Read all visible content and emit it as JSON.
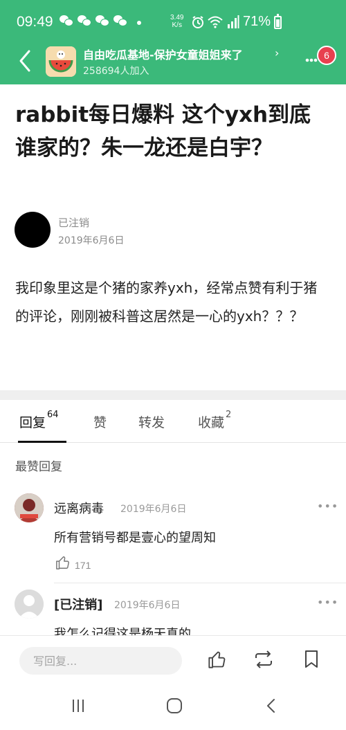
{
  "status": {
    "time": "09:49",
    "speed_top": "3.49",
    "speed_bottom": "K/s",
    "battery": "71%"
  },
  "header": {
    "group_name": "自由吃瓜基地-保护女童姐姐来了",
    "members": "258694人加入",
    "badge": "6"
  },
  "post": {
    "title": "rabbit每日爆料 这个yxh到底谁家的？朱一龙还是白宇？",
    "author": "已注销",
    "date": "2019年6月6日",
    "body": "我印象里这是个猪的家养yxh，经常点赞有利于猪的评论，刚刚被科普这居然是一心的yxh？？？"
  },
  "tabs": [
    {
      "label": "回复",
      "count": "64"
    },
    {
      "label": "赞",
      "count": ""
    },
    {
      "label": "转发",
      "count": ""
    },
    {
      "label": "收藏",
      "count": "2"
    }
  ],
  "section_label": "最赞回复",
  "comments": [
    {
      "name": "远离病毒",
      "date": "2019年6月6日",
      "text": "所有营销号都是壹心的望周知",
      "likes": "171"
    },
    {
      "name": "[已注销]",
      "date": "2019年6月6日",
      "text": "我怎么记得这是杨天真的"
    }
  ],
  "bottom_bar": {
    "placeholder": "写回复..."
  },
  "colors": {
    "brand": "#3bb97a",
    "badge": "#e8404f"
  },
  "icons": [
    "back-arrow-icon",
    "wechat-icon",
    "alarm-icon",
    "wifi-icon",
    "signal-icon",
    "battery-icon",
    "chevron-right-icon",
    "more-dots-icon",
    "thumbs-up-icon",
    "repost-icon",
    "bookmark-icon",
    "recent-apps-icon",
    "home-icon",
    "back-nav-icon"
  ]
}
